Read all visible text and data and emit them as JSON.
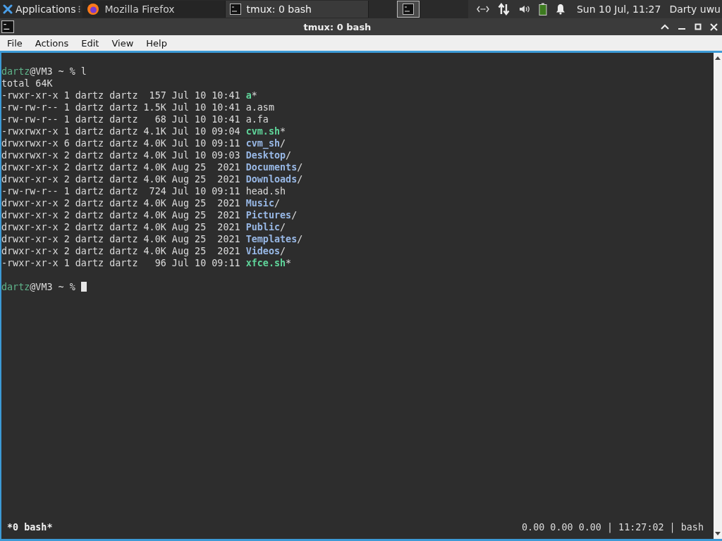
{
  "panel": {
    "applications": "Applications",
    "tasks": [
      {
        "label": "Mozilla Firefox",
        "kind": "browser",
        "selected": false
      },
      {
        "label": "tmux: 0 bash",
        "kind": "terminal",
        "selected": true
      }
    ],
    "clock": "Sun 10 Jul, 11:27",
    "user": "Darty uwu"
  },
  "window": {
    "title": "tmux: 0 bash",
    "menu": [
      "File",
      "Actions",
      "Edit",
      "View",
      "Help"
    ]
  },
  "terminal": {
    "lines": [
      {
        "kind": "prompt",
        "user": "dartz",
        "rest": "@VM3 ~ % l"
      },
      {
        "kind": "text",
        "text": "total 64K"
      },
      {
        "kind": "entry",
        "info": "-rwxr-xr-x 1 dartz dartz  157 Jul 10 10:41 ",
        "name": "a",
        "color": "#5fd59a",
        "bold": true,
        "suffix": "*"
      },
      {
        "kind": "entry",
        "info": "-rw-rw-r-- 1 dartz dartz 1.5K Jul 10 10:41 ",
        "name": "a.asm",
        "color": "#dcdcdc",
        "bold": false
      },
      {
        "kind": "entry",
        "info": "-rw-rw-r-- 1 dartz dartz   68 Jul 10 10:41 ",
        "name": "a.fa",
        "color": "#dcdcdc",
        "bold": false
      },
      {
        "kind": "entry",
        "info": "-rwxrwxr-x 1 dartz dartz 4.1K Jul 10 09:04 ",
        "name": "cvm.sh",
        "color": "#5fd59a",
        "bold": true,
        "suffix": "*"
      },
      {
        "kind": "entry",
        "info": "drwxrwxr-x 6 dartz dartz 4.0K Jul 10 09:11 ",
        "name": "cvm_sh",
        "color": "#98b8e6",
        "bold": true,
        "suffix": "/"
      },
      {
        "kind": "entry",
        "info": "drwxrwxr-x 2 dartz dartz 4.0K Jul 10 09:03 ",
        "name": "Desktop",
        "color": "#98b8e6",
        "bold": true,
        "suffix": "/"
      },
      {
        "kind": "entry",
        "info": "drwxr-xr-x 2 dartz dartz 4.0K Aug 25  2021 ",
        "name": "Documents",
        "color": "#98b8e6",
        "bold": true,
        "suffix": "/"
      },
      {
        "kind": "entry",
        "info": "drwxr-xr-x 2 dartz dartz 4.0K Aug 25  2021 ",
        "name": "Downloads",
        "color": "#98b8e6",
        "bold": true,
        "suffix": "/"
      },
      {
        "kind": "entry",
        "info": "-rw-rw-r-- 1 dartz dartz  724 Jul 10 09:11 ",
        "name": "head.sh",
        "color": "#dcdcdc",
        "bold": false
      },
      {
        "kind": "entry",
        "info": "drwxr-xr-x 2 dartz dartz 4.0K Aug 25  2021 ",
        "name": "Music",
        "color": "#98b8e6",
        "bold": true,
        "suffix": "/"
      },
      {
        "kind": "entry",
        "info": "drwxr-xr-x 2 dartz dartz 4.0K Aug 25  2021 ",
        "name": "Pictures",
        "color": "#98b8e6",
        "bold": true,
        "suffix": "/"
      },
      {
        "kind": "entry",
        "info": "drwxr-xr-x 2 dartz dartz 4.0K Aug 25  2021 ",
        "name": "Public",
        "color": "#98b8e6",
        "bold": true,
        "suffix": "/"
      },
      {
        "kind": "entry",
        "info": "drwxr-xr-x 2 dartz dartz 4.0K Aug 25  2021 ",
        "name": "Templates",
        "color": "#98b8e6",
        "bold": true,
        "suffix": "/"
      },
      {
        "kind": "entry",
        "info": "drwxr-xr-x 2 dartz dartz 4.0K Aug 25  2021 ",
        "name": "Videos",
        "color": "#98b8e6",
        "bold": true,
        "suffix": "/"
      },
      {
        "kind": "entry",
        "info": "-rwxr-xr-x 1 dartz dartz   96 Jul 10 09:11 ",
        "name": "xfce.sh",
        "color": "#5fd59a",
        "bold": true,
        "suffix": "*"
      },
      {
        "kind": "blank"
      },
      {
        "kind": "prompt",
        "user": "dartz",
        "rest": "@VM3 ~ %",
        "cursor": true
      }
    ]
  },
  "status_bar": {
    "window_tab": "*0 bash*",
    "info": "0.00 0.00 0.00 | 11:27:02 | bash"
  }
}
